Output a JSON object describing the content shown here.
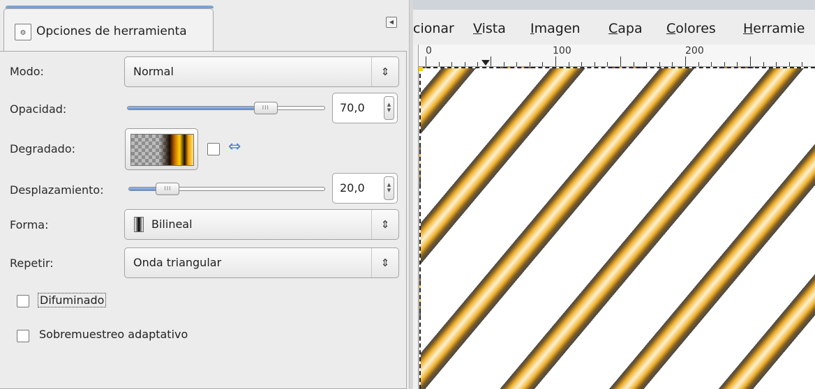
{
  "dock": {
    "tab_label": "Opciones de herramienta",
    "tab_icon": "tool-options-icon",
    "menu_icon": "dock-menu-icon"
  },
  "options": {
    "mode": {
      "label": "Modo:",
      "value": "Normal"
    },
    "opacity": {
      "label": "Opacidad:",
      "value": "70,0",
      "level_percent": 70.0
    },
    "gradient": {
      "label": "Degradado:",
      "reverse_icon": "swap-arrows-icon"
    },
    "offset": {
      "label": "Desplazamiento:",
      "value": "20,0",
      "level_percent": 20.0
    },
    "shape": {
      "label": "Forma:",
      "value": "Bilineal",
      "icon": "bilinear-shape-icon"
    },
    "repeat": {
      "label": "Repetir:",
      "value": "Onda triangular"
    },
    "dither": {
      "label": "Difuminado",
      "checked": false
    },
    "adaptive": {
      "label": "Sobremuestreo adaptativo",
      "checked": false
    }
  },
  "image_window": {
    "menu": [
      {
        "text": "cionar",
        "mnemonic": ""
      },
      {
        "text": "Vista",
        "mnemonic": "V"
      },
      {
        "text": "Imagen",
        "mnemonic": "I"
      },
      {
        "text": "Capa",
        "mnemonic": "C"
      },
      {
        "text": "Colores",
        "mnemonic": "C"
      },
      {
        "text": "Herramie",
        "mnemonic": "H"
      }
    ],
    "ruler_labels": [
      "0",
      "100",
      "200"
    ]
  },
  "colors": {
    "accent_blue": "#5f8fd4",
    "stripe_gold": "#f0b12a",
    "stripe_dark": "#474747"
  }
}
